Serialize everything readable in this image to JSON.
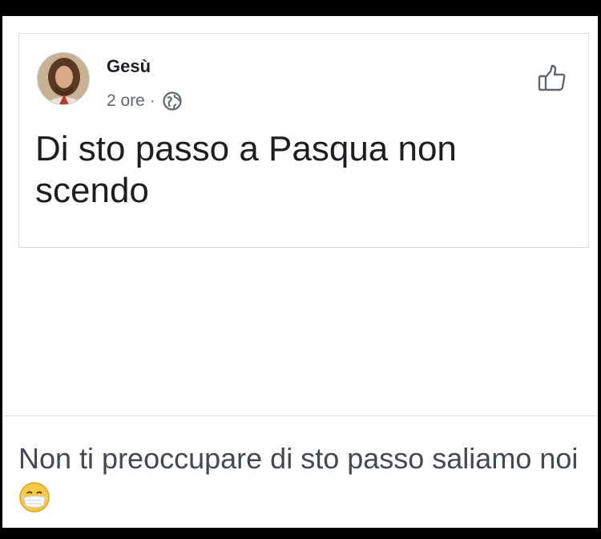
{
  "post": {
    "author": "Gesù",
    "time": "2 ore",
    "separator": "·",
    "privacy_icon": "globe-icon",
    "reaction_icon": "like-icon",
    "text": "Di sto passo a Pasqua non scendo"
  },
  "reply": {
    "text": "Non ti preoccupare di sto passo saliamo noi",
    "emoji": "face-with-medical-mask-emoji"
  },
  "colors": {
    "text_primary": "#1c1e21",
    "text_secondary": "#606770",
    "border": "#dddfe2"
  }
}
